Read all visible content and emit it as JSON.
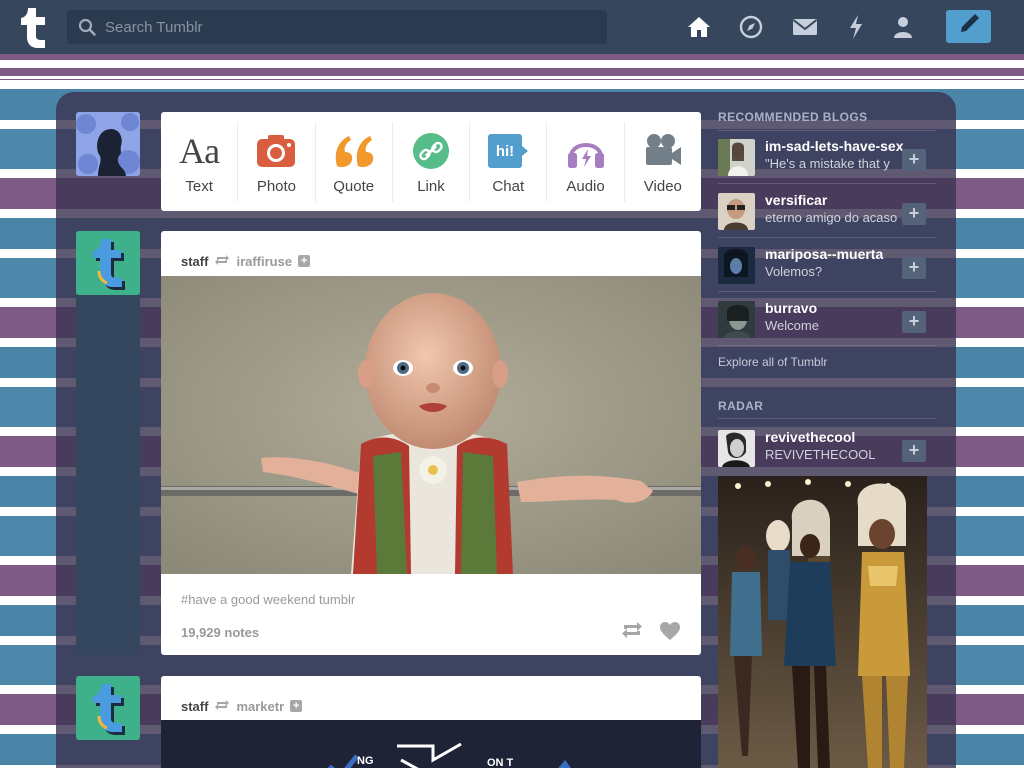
{
  "header": {
    "search_placeholder": "Search Tumblr",
    "nav": [
      "home-icon",
      "explore-icon",
      "inbox-icon",
      "activity-icon",
      "account-icon"
    ],
    "compose_icon": "pencil-icon",
    "accent": "#529ecc"
  },
  "post_types": [
    {
      "label": "Text",
      "icon": "text-icon",
      "color": "#444444"
    },
    {
      "label": "Photo",
      "icon": "camera-icon",
      "color": "#d95e40"
    },
    {
      "label": "Quote",
      "icon": "quote-icon",
      "color": "#f2992e"
    },
    {
      "label": "Link",
      "icon": "link-icon",
      "color": "#56bc8a"
    },
    {
      "label": "Chat",
      "icon": "chat-icon",
      "color": "#529ecc"
    },
    {
      "label": "Audio",
      "icon": "headphones-icon",
      "color": "#a77dc2"
    },
    {
      "label": "Video",
      "icon": "video-camera-icon",
      "color": "#748089"
    }
  ],
  "posts": [
    {
      "author": "staff",
      "reblogged_from": "iraffiruse",
      "tags": "#have a good weekend tumblr",
      "notes": "19,929 notes"
    },
    {
      "author": "staff",
      "reblogged_from": "marketr",
      "image_text": [
        "NG",
        "ON T"
      ]
    }
  ],
  "sidebar": {
    "recommended_title": "RECOMMENDED BLOGS",
    "recommended": [
      {
        "name": "im-sad-lets-have-sex",
        "sub": "\"He's a mistake that y"
      },
      {
        "name": "versificar",
        "sub": "eterno amigo do acaso"
      },
      {
        "name": "mariposa--muerta",
        "sub": "Volemos?"
      },
      {
        "name": "burravo",
        "sub": "Welcome"
      }
    ],
    "explore_link": "Explore all of Tumblr",
    "radar_title": "RADAR",
    "radar": {
      "name": "revivethecool",
      "sub": "REVIVETHECOOL"
    }
  }
}
